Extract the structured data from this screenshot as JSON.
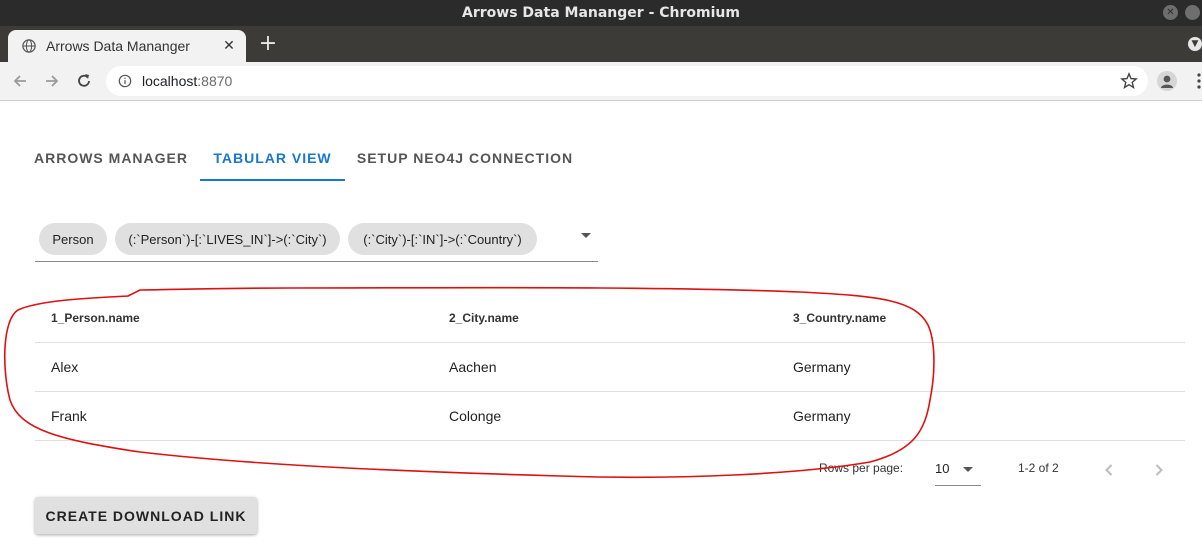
{
  "window": {
    "title": "Arrows Data Mananger - Chromium"
  },
  "browser": {
    "tab_title": "Arrows Data Mananger",
    "new_tab_symbol": "+",
    "url_host": "localhost",
    "url_port": ":8870"
  },
  "app_tabs": [
    {
      "label": "ARROWS MANAGER",
      "active": false
    },
    {
      "label": "TABULAR VIEW",
      "active": true
    },
    {
      "label": "SETUP NEO4J CONNECTION",
      "active": false
    }
  ],
  "chips": [
    "Person",
    "(:`Person`)-[:`LIVES_IN`]->(:`City`)",
    "(:`City`)-[:`IN`]->(:`Country`)"
  ],
  "table": {
    "columns": [
      "1_Person.name",
      "2_City.name",
      "3_Country.name"
    ],
    "rows": [
      [
        "Alex",
        "Aachen",
        "Germany"
      ],
      [
        "Frank",
        "Colonge",
        "Germany"
      ]
    ]
  },
  "pagination": {
    "rows_per_page_label": "Rows per page:",
    "rows_per_page": "10",
    "range": "1-2 of 2"
  },
  "download_button": "CREATE DOWNLOAD LINK",
  "colors": {
    "accent": "#1976d2",
    "annotation": "#e01010",
    "chip_bg": "#e0e0e0"
  },
  "icons": [
    "globe-icon",
    "close-icon",
    "back-arrow-icon",
    "forward-arrow-icon",
    "reload-icon",
    "info-icon",
    "star-icon",
    "profile-icon",
    "kebab-menu-icon",
    "chevron-left-icon",
    "chevron-right-icon"
  ]
}
